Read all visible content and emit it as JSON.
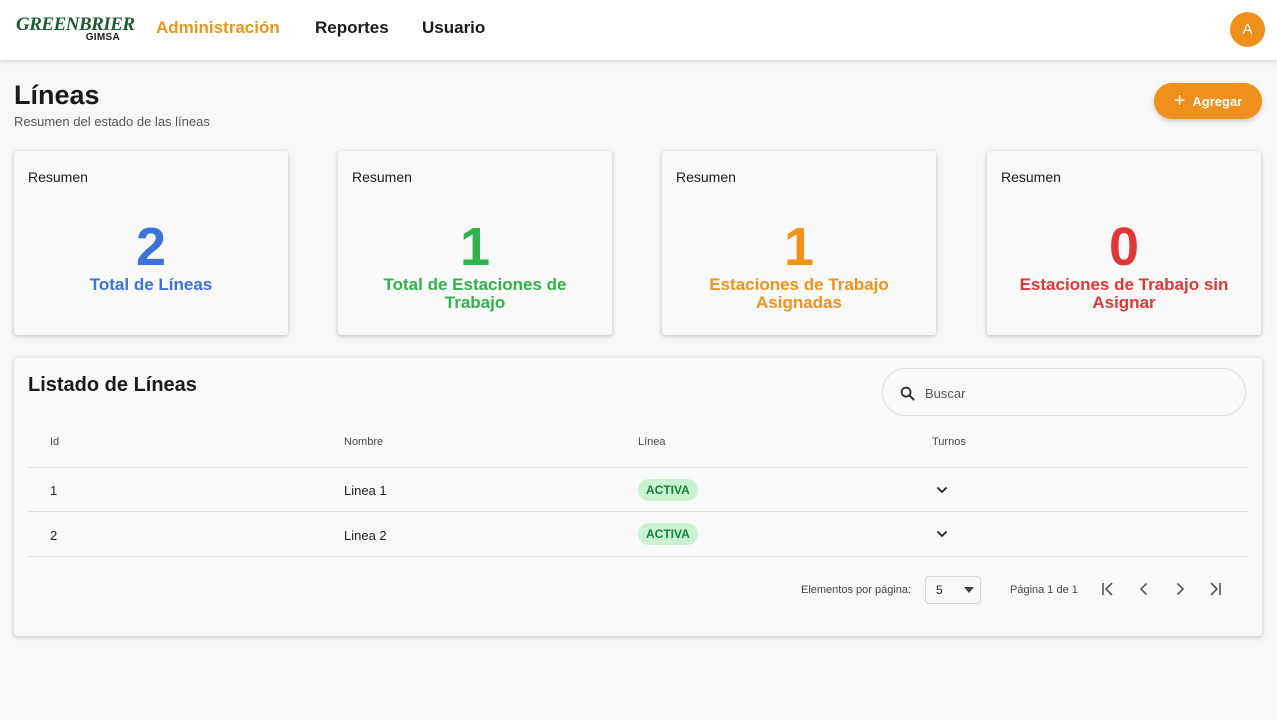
{
  "brand": {
    "name": "GREENBRIER",
    "sub": "GIMSA"
  },
  "nav": {
    "items": [
      {
        "label": "Administración",
        "active": true
      },
      {
        "label": "Reportes",
        "active": false
      },
      {
        "label": "Usuario",
        "active": false
      }
    ],
    "avatar_initial": "A"
  },
  "header": {
    "title": "Líneas",
    "subtitle": "Resumen del estado de las líneas",
    "add_label": "Agregar"
  },
  "cards": [
    {
      "label": "Resumen",
      "value": "2",
      "caption": "Total de Líneas",
      "color": "#3b73d9"
    },
    {
      "label": "Resumen",
      "value": "1",
      "caption": "Total de Estaciones de Trabajo",
      "color": "#2fb34a"
    },
    {
      "label": "Resumen",
      "value": "1",
      "caption": "Estaciones de Trabajo Asignadas",
      "color": "#f0921c"
    },
    {
      "label": "Resumen",
      "value": "0",
      "caption": "Estaciones de Trabajo sin Asignar",
      "color": "#e03636"
    }
  ],
  "table": {
    "title": "Listado de Líneas",
    "search_placeholder": "Buscar",
    "columns": [
      "Id",
      "Nombre",
      "Línea",
      "Turnos"
    ],
    "rows": [
      {
        "id": "1",
        "name": "Linea 1",
        "status": "ACTIVA"
      },
      {
        "id": "2",
        "name": "Linea 2",
        "status": "ACTIVA"
      }
    ],
    "pagination": {
      "per_page_label": "Elementos por página:",
      "per_page_value": "5",
      "page_info": "Página 1 de 1"
    }
  },
  "icons": {
    "search": "search-icon",
    "plus": "plus-icon",
    "expand": "chevron-down-icon",
    "first": "first-page-icon",
    "prev": "chevron-left-icon",
    "next": "chevron-right-icon",
    "last": "last-page-icon"
  },
  "colors": {
    "accent": "#f0901c",
    "status_bg": "#c9f2d3",
    "status_text": "#148038"
  }
}
